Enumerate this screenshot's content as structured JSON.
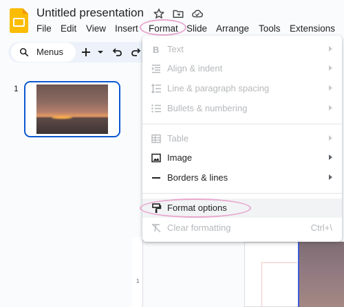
{
  "app": {
    "doc_title": "Untitled presentation",
    "brand_color": "#fbbc04",
    "accent_color": "#0b57d0",
    "highlight_color": "#e9a6cf"
  },
  "title_icons": [
    "star-icon",
    "move-to-folder-icon",
    "cloud-saved-icon"
  ],
  "menubar": {
    "items": [
      "File",
      "Edit",
      "View",
      "Insert",
      "Format",
      "Slide",
      "Arrange",
      "Tools",
      "Extensions"
    ],
    "active": "Format"
  },
  "toolbar": {
    "search_label": "Menus",
    "icons": [
      "search-icon",
      "add-icon",
      "dropdown-arrow-icon",
      "undo-icon",
      "redo-icon"
    ]
  },
  "filmstrip": {
    "slides": [
      {
        "number": "1"
      }
    ]
  },
  "editor": {
    "ruler_label": "1"
  },
  "dropdown": {
    "sections": [
      {
        "items": [
          {
            "label": "Text",
            "icon": "bold-icon",
            "enabled": false,
            "submenu": true
          },
          {
            "label": "Align & indent",
            "icon": "align-indent-icon",
            "enabled": false,
            "submenu": true
          },
          {
            "label": "Line & paragraph spacing",
            "icon": "line-spacing-icon",
            "enabled": false,
            "submenu": true
          },
          {
            "label": "Bullets & numbering",
            "icon": "bulleted-list-icon",
            "enabled": false,
            "submenu": true
          }
        ]
      },
      {
        "items": [
          {
            "label": "Table",
            "icon": "table-icon",
            "enabled": false,
            "submenu": true
          },
          {
            "label": "Image",
            "icon": "image-icon",
            "enabled": true,
            "submenu": true
          },
          {
            "label": "Borders & lines",
            "icon": "line-icon",
            "enabled": true,
            "submenu": true
          }
        ]
      },
      {
        "items": [
          {
            "label": "Format options",
            "icon": "paint-roller-icon",
            "enabled": true,
            "submenu": false,
            "hovered": true
          },
          {
            "label": "Clear formatting",
            "icon": "clear-formatting-icon",
            "enabled": false,
            "submenu": false,
            "shortcut": "Ctrl+\\"
          }
        ]
      }
    ]
  }
}
